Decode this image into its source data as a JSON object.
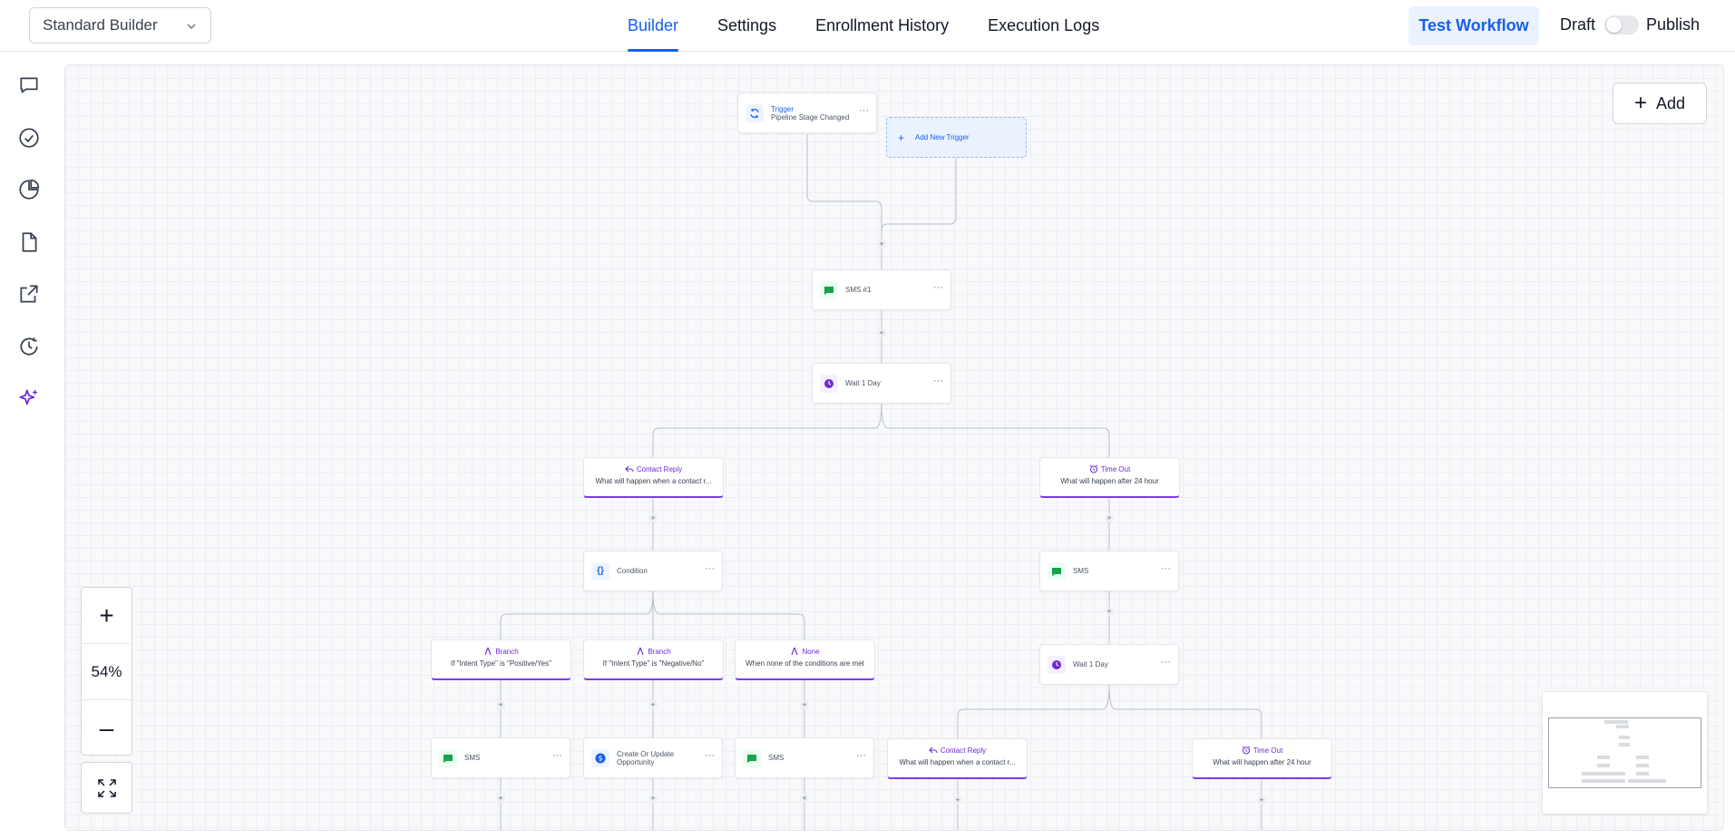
{
  "header": {
    "builder_select": "Standard Builder",
    "tabs": [
      {
        "label": "Builder",
        "active": true
      },
      {
        "label": "Settings",
        "active": false
      },
      {
        "label": "Enrollment History",
        "active": false
      },
      {
        "label": "Execution Logs",
        "active": false
      }
    ],
    "test_workflow": "Test Workflow",
    "draft": "Draft",
    "publish": "Publish",
    "published": false
  },
  "sidebar": {
    "icons": [
      "chat-bubble-icon",
      "check-circle-icon",
      "pie-chart-icon",
      "file-icon",
      "external-link-icon",
      "clock-history-icon",
      "sparkles-icon"
    ]
  },
  "canvas": {
    "add_button": "Add",
    "add_trigger": "Add New Trigger",
    "trigger": {
      "title": "Trigger",
      "subtitle": "Pipeline Stage Changed"
    },
    "sms1": "SMS #1",
    "wait1": "Wait 1 Day",
    "contact_reply": {
      "title": "Contact Reply",
      "subtitle": "What will happen when a contact r..."
    },
    "time_out": {
      "title": "Time Out",
      "subtitle": "What will happen after 24 hour"
    },
    "condition": "Condition",
    "sms_right": "SMS",
    "wait_right": "Wait 1 Day",
    "branch_yes": {
      "title": "Branch",
      "subtitle": "If \"Intent Type\" is \"Positive/Yes\""
    },
    "branch_no": {
      "title": "Branch",
      "subtitle": "If \"Intent Type\" is \"Negative/No\""
    },
    "branch_none": {
      "title": "None",
      "subtitle": "When none of the conditions are met"
    },
    "sms_a": "SMS",
    "opportunity": {
      "line1": "Create Or Update",
      "line2": "Opportunity"
    },
    "sms_b": "SMS",
    "contact_reply_2": {
      "title": "Contact Reply",
      "subtitle": "What will happen when a contact r..."
    },
    "time_out_2": {
      "title": "Time Out",
      "subtitle": "What will happen after 24 hour"
    },
    "zoom_level": "54%",
    "colors": {
      "accent": "#155eef",
      "branch": "#7c3aed",
      "sms": "#16a34a",
      "wait": "#6d28d9"
    }
  }
}
